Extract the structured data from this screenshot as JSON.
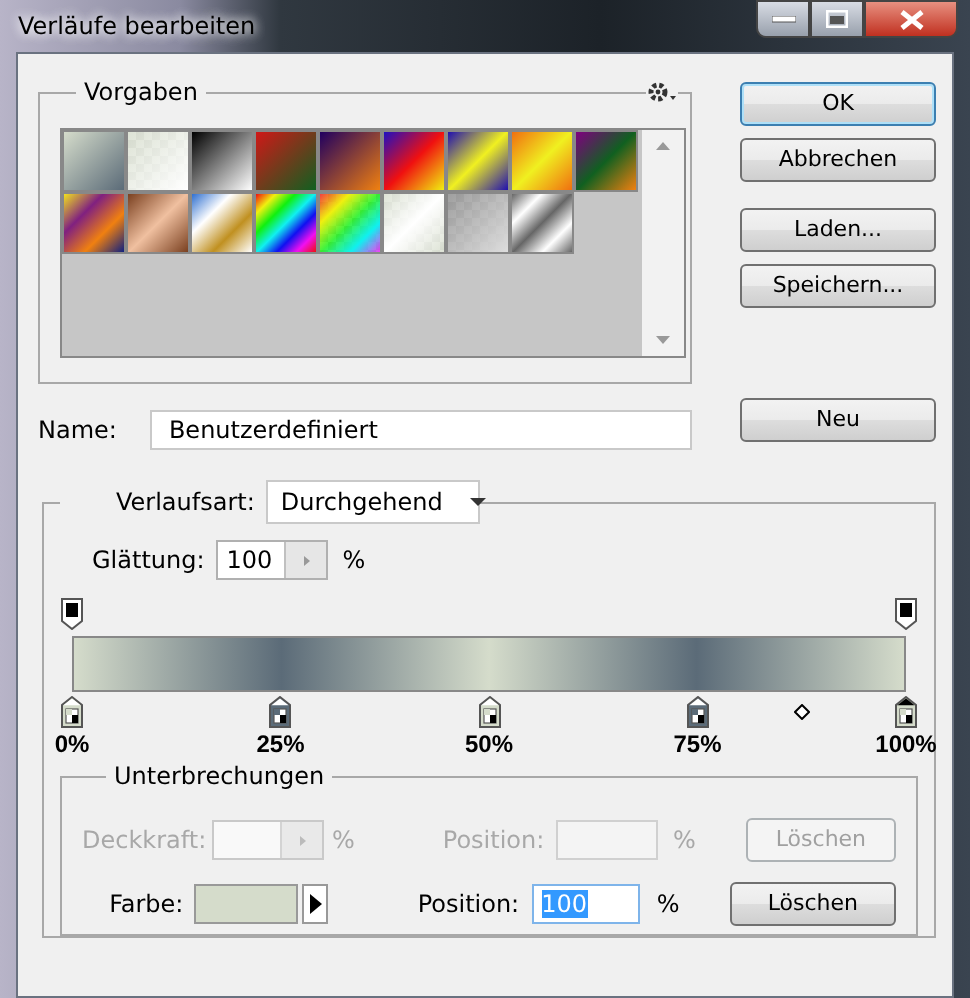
{
  "window": {
    "title": "Verläufe bearbeiten"
  },
  "presets": {
    "legend": "Vorgaben"
  },
  "buttons": [
    {
      "label": "OK",
      "default": true
    },
    {
      "label": "Abbrechen",
      "default": false
    },
    {
      "label": "Laden...",
      "default": false
    },
    {
      "label": "Speichern...",
      "default": false
    }
  ],
  "name": {
    "label": "Name:",
    "value": "Benutzerdefiniert",
    "button": "Neu"
  },
  "gradient_type": {
    "label": "Verlaufsart:",
    "value": "Durchgehend"
  },
  "smoothness": {
    "label": "Glättung:",
    "value": "100",
    "unit": "%"
  },
  "opacity_stops": [
    {
      "level": 0
    },
    {
      "level": 1
    }
  ],
  "color_stops": [
    {
      "level": 0,
      "color": "#d5dccb",
      "label": "0%",
      "selected": false
    },
    {
      "level": 0.25,
      "color": "#5b6b78",
      "label": "25%",
      "selected": false
    },
    {
      "level": 0.5,
      "color": "#d5dccb",
      "label": "50%",
      "selected": false
    },
    {
      "level": 0.75,
      "color": "#5b6b78",
      "label": "75%",
      "selected": false
    },
    {
      "level": 1,
      "color": "#d5dccb",
      "label": "100%",
      "selected": true
    }
  ],
  "midpoint": {
    "level": 0.875
  },
  "stops": {
    "legend": "Unterbrechungen",
    "opacity_row": {
      "label": "Deckkraft:",
      "unit": "%",
      "position_label": "Position:",
      "position_unit": "%",
      "button": "Löschen",
      "disabled": true
    },
    "color_row": {
      "label": "Farbe:",
      "color": "#d5dccb",
      "position_label": "Position:",
      "position_value": "100",
      "position_unit": "%",
      "button": "Löschen",
      "disabled": false
    }
  }
}
